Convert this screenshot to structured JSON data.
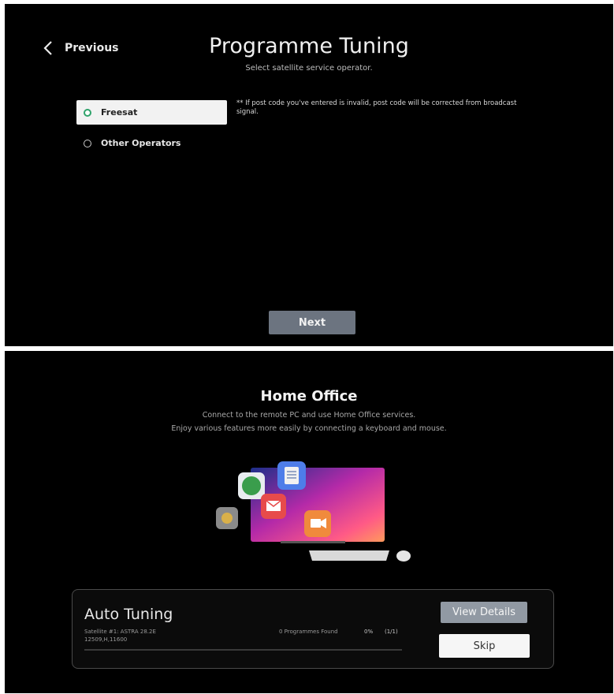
{
  "tuning": {
    "back_label": "Previous",
    "title": "Programme Tuning",
    "subtitle": "Select satellite service operator.",
    "options": [
      {
        "label": "Freesat",
        "selected": true
      },
      {
        "label": "Other Operators",
        "selected": false
      }
    ],
    "note": "** If post code you've entered is invalid, post code will be corrected from broadcast signal.",
    "next_label": "Next"
  },
  "home_office": {
    "title": "Home Office",
    "line1": "Connect to the remote PC and use Home Office services.",
    "line2": "Enjoy various features more easily by connecting a keyboard and mouse."
  },
  "auto_tuning": {
    "title": "Auto Tuning",
    "satellite": "Satellite #1: ASTRA 28.2E",
    "frequency": "12509,H,11600",
    "programmes_found": "0 Programmes Found",
    "percent": "0%",
    "count": "(1/1)",
    "progress": 0,
    "view_details_label": "View Details",
    "skip_label": "Skip"
  },
  "colors": {
    "background": "#000000",
    "radio_selected": "#2fa36b",
    "next_button": "#6c7480",
    "view_details_button": "#9199a3"
  },
  "icons": [
    "chevron-left-icon",
    "radio-selected-icon",
    "radio-unselected-icon",
    "home-office-illustration"
  ]
}
